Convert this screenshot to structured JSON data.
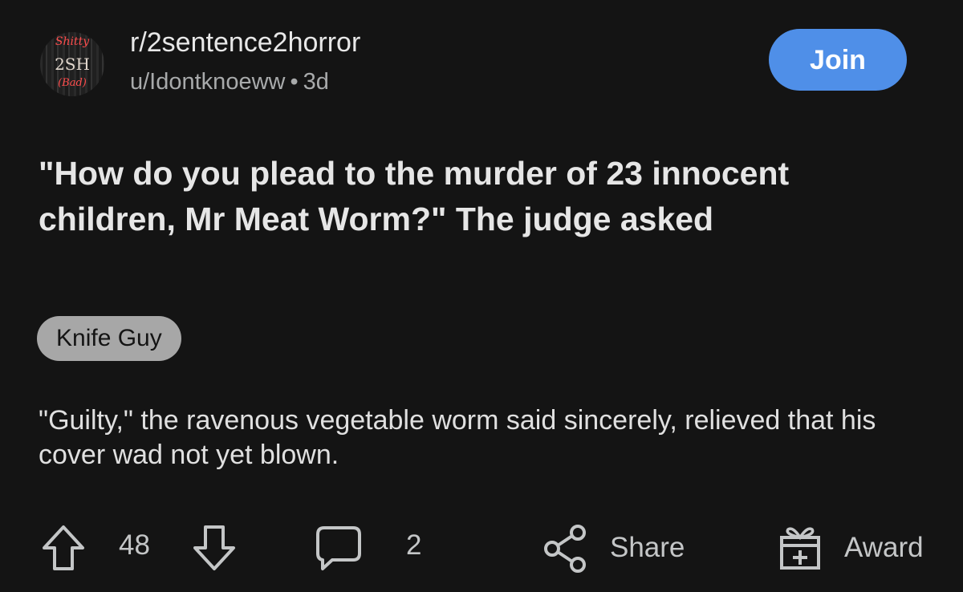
{
  "post": {
    "subreddit": "r/2sentence2horror",
    "author": "u/Idontknoeww",
    "age": "3d",
    "meta_separator": "•",
    "join_label": "Join",
    "title": "\"How do you plead to the murder of 23 innocent children, Mr Meat Worm?\" The judge asked",
    "flair": "Knife Guy",
    "body": "\"Guilty,\" the ravenous vegetable worm said sincerely, relieved that his cover wad not yet blown."
  },
  "avatar": {
    "line1": "Shitty",
    "line2": "2SH",
    "line3": "(Bad)"
  },
  "actions": {
    "score": "48",
    "comment_count": "2",
    "share_label": "Share",
    "award_label": "Award"
  },
  "colors": {
    "background": "#141414",
    "join_button": "#4f8fe8",
    "flair_bg": "#a7a7a7"
  },
  "icons": [
    "upvote-icon",
    "downvote-icon",
    "comment-icon",
    "share-icon",
    "award-icon"
  ]
}
